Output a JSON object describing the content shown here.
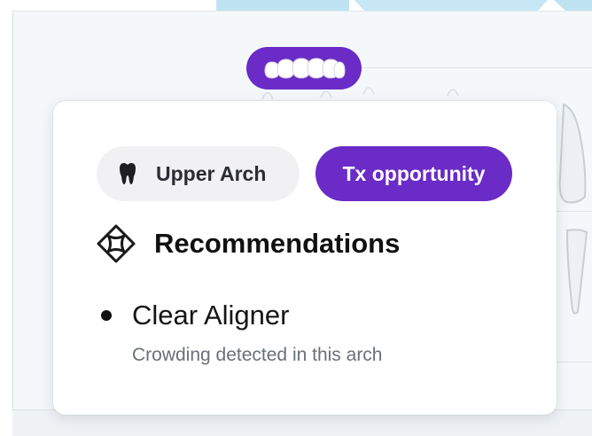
{
  "popover": {
    "arch_chip_label": "Upper Arch",
    "tx_chip_label": "Tx opportunity",
    "section_title": "Recommendations",
    "recommendations": [
      {
        "title": "Clear Aligner",
        "detail": "Crowding detected in this arch"
      }
    ]
  },
  "icons": {
    "arch_chip_icon": "tooth-icon",
    "section_icon": "aligner-logo-icon",
    "selected_arch_icon": "upper-teeth-icon"
  },
  "colors": {
    "accent_purple": "#6a2bc6",
    "chip_gray": "#f1f1f3",
    "background": "#f4f8fb",
    "stripe_blue": "#bfe3f1"
  }
}
